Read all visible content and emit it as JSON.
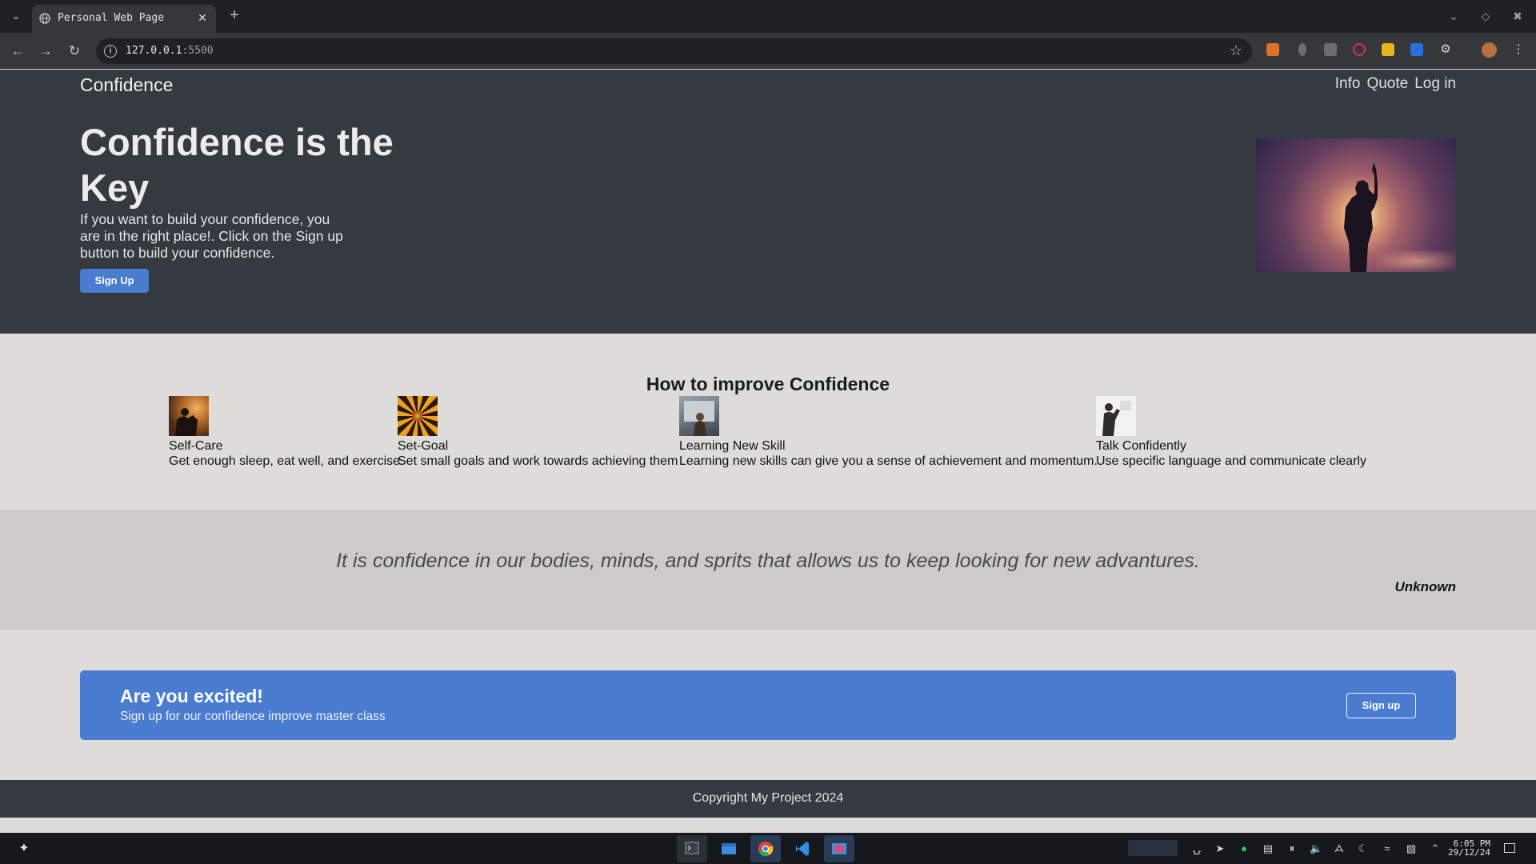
{
  "browser": {
    "tab_title": "Personal Web Page",
    "new_tab_symbol": "+",
    "url_host": "127.0.0.1",
    "url_port": ":5500"
  },
  "site": {
    "brand": "Confidence",
    "nav": [
      "Info",
      "Quote",
      "Log in"
    ]
  },
  "hero": {
    "title": "Confidence is the Key",
    "text": "If you want to build your confidence, you are in the right place!. Click on the Sign up button to build your confidence.",
    "button": "Sign Up"
  },
  "improve": {
    "title": "How to improve Confidence",
    "tips": [
      {
        "title": "Self-Care",
        "desc": "Get enough sleep, eat well, and exercise."
      },
      {
        "title": "Set-Goal",
        "desc": "Set small goals and work towards achieving them"
      },
      {
        "title": "Learning New Skill",
        "desc": "Learning new skills can give you a sense of achievement and momentum."
      },
      {
        "title": "Talk Confidently",
        "desc": "Use specific language and communicate clearly"
      }
    ]
  },
  "quote": {
    "text": "It is confidence in our bodies, minds, and sprits that allows us to keep looking for new advantures.",
    "author": "Unknown"
  },
  "cta": {
    "title": "Are you excited!",
    "subtitle": "Sign up for our confidence improve master class",
    "button": "Sign up"
  },
  "footer": {
    "text": "Copyright My Project 2024"
  },
  "taskbar": {
    "time": "6:05 PM",
    "date": "29/12/24"
  },
  "colors": {
    "hero_bg": "#343a40",
    "accent_blue": "#4a7ccf",
    "quote_bg": "#cdcbc7",
    "page_bg": "#dddcda"
  }
}
